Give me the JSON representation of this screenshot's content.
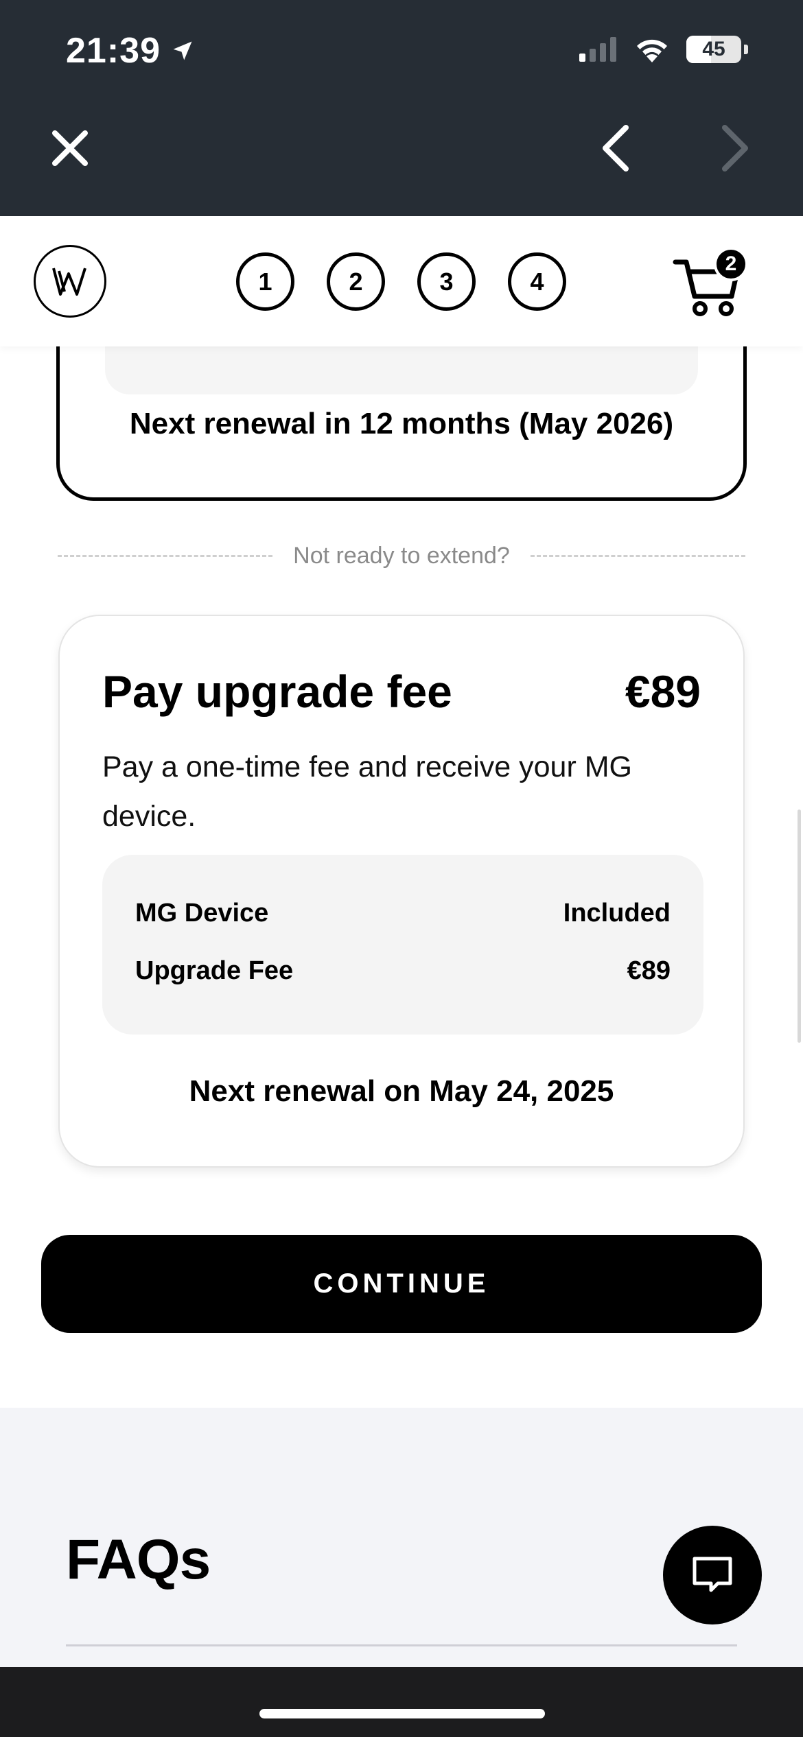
{
  "status_bar": {
    "time": "21:39",
    "battery_level": "45",
    "battery_fraction": 0.45,
    "icons": [
      "location-arrow-icon",
      "cellular-signal-icon",
      "wifi-icon",
      "battery-icon"
    ]
  },
  "browser_nav": {
    "icons": [
      "close-icon",
      "chevron-left-icon",
      "chevron-right-icon"
    ]
  },
  "header": {
    "steps": [
      "1",
      "2",
      "3",
      "4"
    ],
    "cart_count": "2"
  },
  "plan_card": {
    "renewal_text": "Next renewal in 12 months (May 2026)"
  },
  "divider": {
    "label": "Not ready to extend?"
  },
  "upgrade_card": {
    "title": "Pay upgrade fee",
    "price": "€89",
    "description": "Pay a one-time fee and receive your MG device.",
    "rows": [
      {
        "label": "MG Device",
        "value": "Included"
      },
      {
        "label": "Upgrade Fee",
        "value": "€89"
      }
    ],
    "next_renewal": "Next renewal on May 24, 2025"
  },
  "continue_button": {
    "label": "CONTINUE"
  },
  "faq": {
    "title": "FAQs"
  },
  "colors": {
    "top_bar": "#262d35",
    "primary": "#000000",
    "faq_background": "#f3f4f8",
    "box_background": "#f4f4f4"
  }
}
